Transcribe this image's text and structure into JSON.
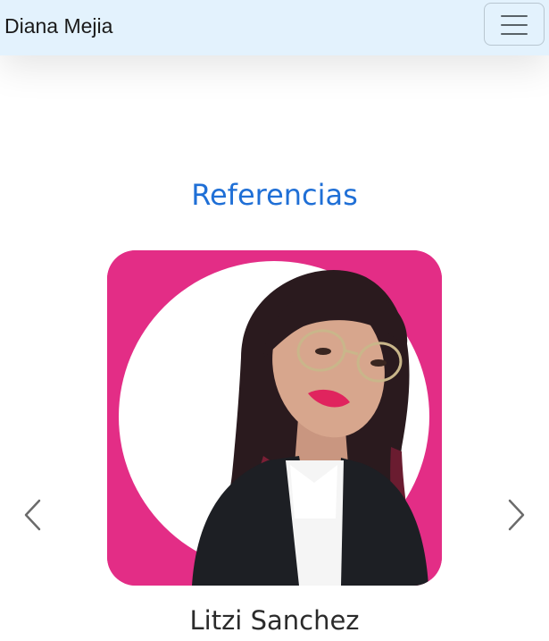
{
  "navbar": {
    "brand": "Diana Mejia",
    "toggler_icon": "hamburger-menu-icon"
  },
  "section": {
    "title": "Referencias"
  },
  "carousel": {
    "prev_icon": "chevron-left-icon",
    "next_icon": "chevron-right-icon",
    "slide": {
      "photo_icon": "profile-photo",
      "name": "Litzi Sanchez"
    }
  },
  "colors": {
    "navbar_bg": "#e3f2fd",
    "title": "#1f6fd6",
    "photo_bg": "#e32d86",
    "name_text": "#2b2b2b"
  }
}
